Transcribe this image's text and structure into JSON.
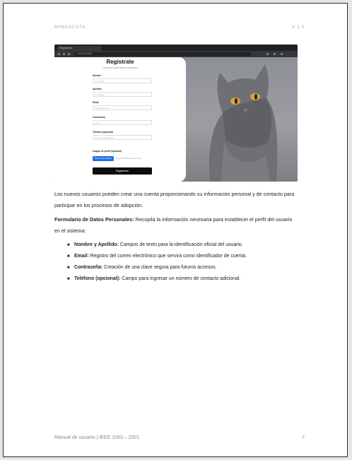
{
  "header": {
    "left": "MIMASCOTA",
    "right": "V 1.0"
  },
  "screenshot": {
    "tab_title": "Registrarse",
    "url": "localhost:3000",
    "form": {
      "title": "Regístrate",
      "subtitle": "Crea una cuenta para la aplicación",
      "fields": [
        {
          "label": "Nombre",
          "placeholder": "Tu nombre"
        },
        {
          "label": "Apellido",
          "placeholder": "Tu apellido"
        },
        {
          "label": "Email",
          "placeholder": "tu@ejemplo.com"
        },
        {
          "label": "Contraseña",
          "placeholder": "••••••••"
        },
        {
          "label": "Teléfono (opcional)",
          "placeholder": "Tu número de teléfono"
        },
        {
          "label": "Imagen de perfil (Opcional)",
          "placeholder": ""
        }
      ],
      "file_button": "Seleccionar archivo",
      "file_status": "Ningún archivo seleccionado",
      "submit": "Registrarse"
    }
  },
  "intro": "Los nuevos usuarios pueden crear una cuenta proporcionando su información personal y de contacto para participar en los procesos de adopción.",
  "section": {
    "title": "Formulario de Datos Personales:",
    "text": " Recopila la información necesaria para establecer el perfil del usuario en el sistema:"
  },
  "bullets": [
    {
      "term": "Nombre y Apellido:",
      "desc": " Campos de texto para la identificación oficial del usuario."
    },
    {
      "term": "Email:",
      "desc": " Registro del correo electrónico que servirá como identificador de cuenta."
    },
    {
      "term": "Contraseña:",
      "desc": " Creación de una clave segura para futuros accesos."
    },
    {
      "term": "Teléfono (opcional):",
      "desc": " Campo para ingresar un número de contacto adicional."
    }
  ],
  "footer": {
    "left": "Manual de usuario | IEEE 1063 – 2001",
    "right": "7"
  }
}
